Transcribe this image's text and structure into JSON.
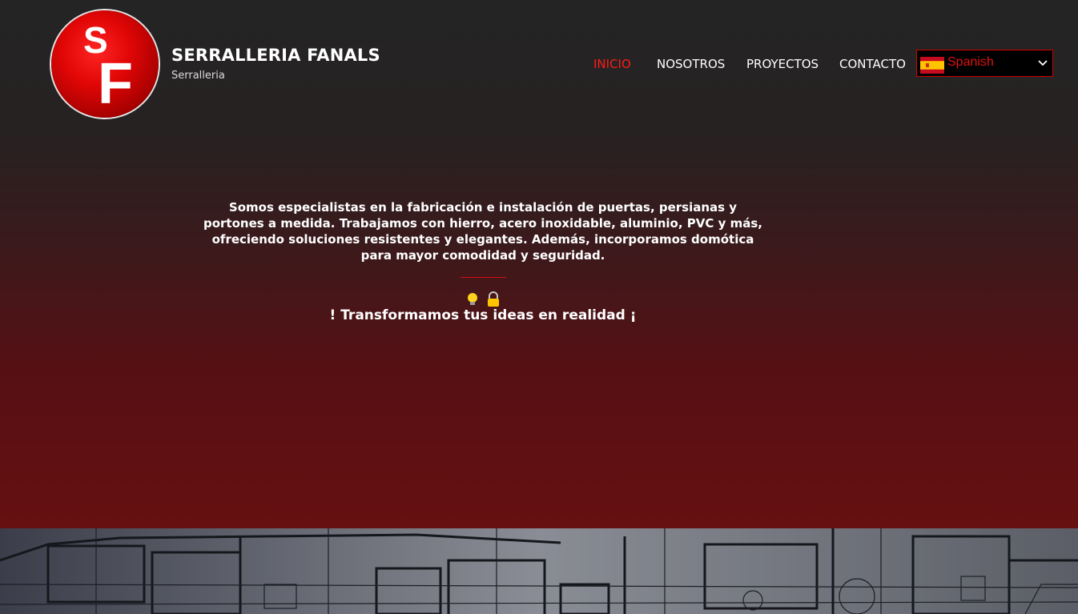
{
  "header": {
    "logo": {
      "letter_top": "S",
      "letter_bottom": "F",
      "color": "#d40000"
    },
    "title": "SERRALLERIA FANALS",
    "subtitle": "Serralleria"
  },
  "nav": {
    "items": [
      {
        "label": "INICIO",
        "active": true
      },
      {
        "label": "NOSOTROS",
        "active": false
      },
      {
        "label": "PROYECTOS",
        "active": false
      },
      {
        "label": "CONTACTO",
        "active": false
      }
    ],
    "active_color": "#ff1a1a"
  },
  "language_selector": {
    "selected": "Spanish",
    "flag_icon": "spain-flag-icon",
    "chevron_icon": "chevron-down-icon"
  },
  "hero": {
    "intro": "Somos especialistas en la fabricación e instalación de puertas, persianas y portones a medida. Trabajamos con hierro, acero inoxidable, aluminio, PVC y más, ofreciendo soluciones resistentes y elegantes. Además, incorporamos domótica para mayor comodidad y seguridad.",
    "icons": [
      "light-bulb-icon",
      "lock-icon"
    ],
    "tagline": "! Transformamos tus ideas en realidad ¡",
    "gradient_colors": [
      "#242424",
      "#661011"
    ]
  },
  "blueprint_section": {
    "background_icon": "blueprint-drawing"
  }
}
